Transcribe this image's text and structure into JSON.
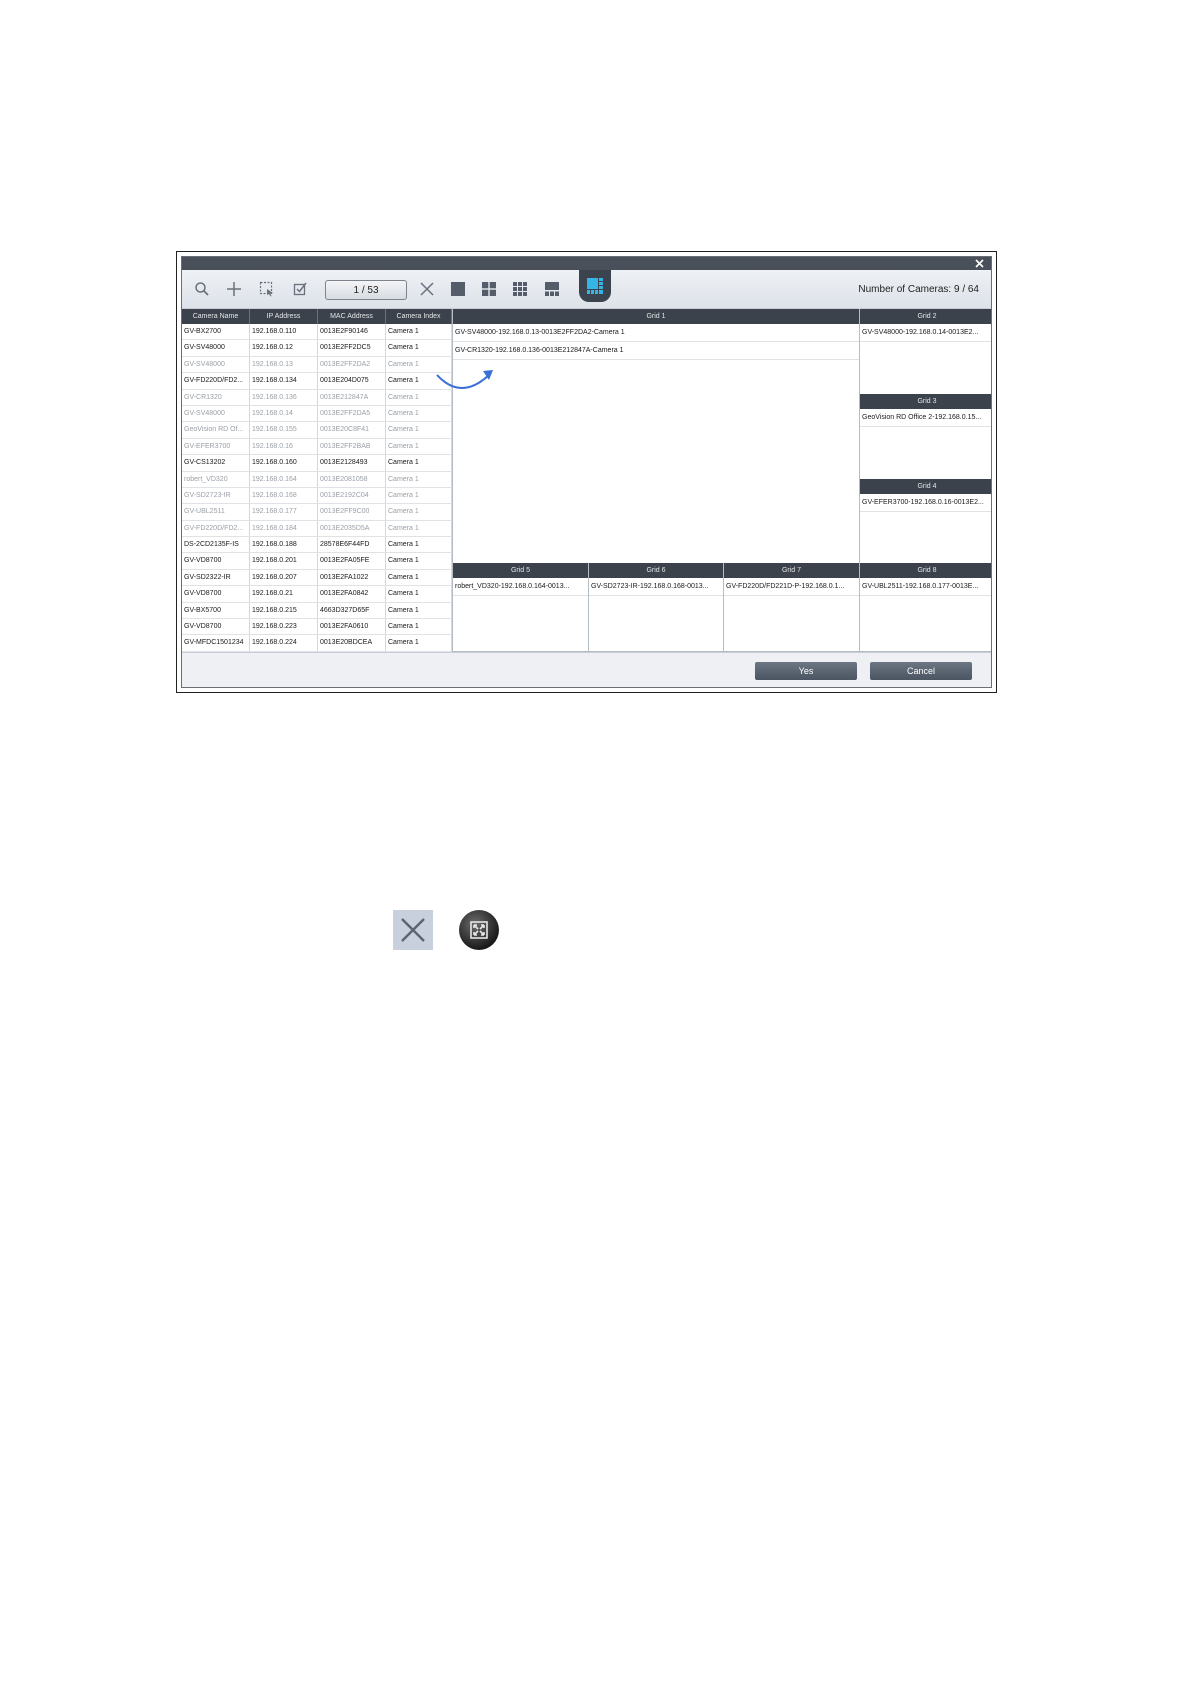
{
  "toolbar": {
    "page_indicator": "1 / 53",
    "camera_count": "Number of Cameras: 9 / 64"
  },
  "camera_table": {
    "headers": [
      "Camera Name",
      "IP Address",
      "MAC Address",
      "Camera Index"
    ],
    "rows": [
      {
        "name": "GV-BX2700",
        "ip": "192.168.0.110",
        "mac": "0013E2F90146",
        "index": "Camera 1",
        "dim": false
      },
      {
        "name": "GV-SV48000",
        "ip": "192.168.0.12",
        "mac": "0013E2FF2DC5",
        "index": "Camera 1",
        "dim": false
      },
      {
        "name": "GV-SV48000",
        "ip": "192.168.0.13",
        "mac": "0013E2FF2DA2",
        "index": "Camera 1",
        "dim": true
      },
      {
        "name": "GV-FD220D/FD2...",
        "ip": "192.168.0.134",
        "mac": "0013E204D075",
        "index": "Camera 1",
        "dim": false
      },
      {
        "name": "GV-CR1320",
        "ip": "192.168.0.136",
        "mac": "0013E212847A",
        "index": "Camera 1",
        "dim": true
      },
      {
        "name": "GV-SV48000",
        "ip": "192.168.0.14",
        "mac": "0013E2FF2DA5",
        "index": "Camera 1",
        "dim": true
      },
      {
        "name": "GeoVision RD Of...",
        "ip": "192.168.0.155",
        "mac": "0013E20C8F41",
        "index": "Camera 1",
        "dim": true
      },
      {
        "name": "GV-EFER3700",
        "ip": "192.168.0.16",
        "mac": "0013E2FF2BAB",
        "index": "Camera 1",
        "dim": true
      },
      {
        "name": "GV-CS13202",
        "ip": "192.168.0.160",
        "mac": "0013E2128493",
        "index": "Camera 1",
        "dim": false
      },
      {
        "name": "robert_VD320",
        "ip": "192.168.0.164",
        "mac": "0013E2081058",
        "index": "Camera 1",
        "dim": true
      },
      {
        "name": "GV-SD2723-IR",
        "ip": "192.168.0.168",
        "mac": "0013E2192C04",
        "index": "Camera 1",
        "dim": true
      },
      {
        "name": "GV-UBL2511",
        "ip": "192.168.0.177",
        "mac": "0013E2FF9C00",
        "index": "Camera 1",
        "dim": true
      },
      {
        "name": "GV-FD220D/FD2...",
        "ip": "192.168.0.184",
        "mac": "0013E2035D5A",
        "index": "Camera 1",
        "dim": true
      },
      {
        "name": "DS-2CD2135F-IS",
        "ip": "192.168.0.188",
        "mac": "28578E6F44FD",
        "index": "Camera 1",
        "dim": false
      },
      {
        "name": "GV-VD8700",
        "ip": "192.168.0.201",
        "mac": "0013E2FA05FE",
        "index": "Camera 1",
        "dim": false
      },
      {
        "name": "GV-SD2322-IR",
        "ip": "192.168.0.207",
        "mac": "0013E2FA1022",
        "index": "Camera 1",
        "dim": false
      },
      {
        "name": "GV-VD8700",
        "ip": "192.168.0.21",
        "mac": "0013E2FA0842",
        "index": "Camera 1",
        "dim": false
      },
      {
        "name": "GV-BX5700",
        "ip": "192.168.0.215",
        "mac": "4663D327D65F",
        "index": "Camera 1",
        "dim": false
      },
      {
        "name": "GV-VD8700",
        "ip": "192.168.0.223",
        "mac": "0013E2FA0610",
        "index": "Camera 1",
        "dim": false
      },
      {
        "name": "GV-MFDC1501234",
        "ip": "192.168.0.224",
        "mac": "0013E20BDCEA",
        "index": "Camera 1",
        "dim": false
      }
    ]
  },
  "grids": {
    "grid1": {
      "title": "Grid 1",
      "items": [
        "GV-SV48000-192.168.0.13-0013E2FF2DA2-Camera 1",
        "GV-CR1320-192.168.0.136-0013E212847A-Camera 1"
      ]
    },
    "grid2": {
      "title": "Grid 2",
      "items": [
        "GV-SV48000-192.168.0.14-0013E2..."
      ]
    },
    "grid3": {
      "title": "Grid 3",
      "items": [
        "GeoVision RD Office 2-192.168.0.15..."
      ]
    },
    "grid4": {
      "title": "Grid 4",
      "items": [
        "GV-EFER3700-192.168.0.16-0013E2..."
      ]
    },
    "grid5": {
      "title": "Grid 5",
      "items": [
        "robert_VD320-192.168.0.164-0013..."
      ]
    },
    "grid6": {
      "title": "Grid 6",
      "items": [
        "GV-SD2723-IR-192.168.0.168-0013..."
      ]
    },
    "grid7": {
      "title": "Grid 7",
      "items": [
        "GV-FD220D/FD221D-P-192.168.0.1..."
      ]
    },
    "grid8": {
      "title": "Grid 8",
      "items": [
        "GV-UBL2511-192.168.0.177-0013E..."
      ]
    }
  },
  "footer": {
    "yes_label": "Yes",
    "cancel_label": "Cancel"
  },
  "colors": {
    "header_dark": "#3b424b",
    "active_icon": "#35b5e6",
    "arrow": "#3a6fd8",
    "button": "#5a6470"
  },
  "icons": [
    "search-icon",
    "add-icon",
    "select-icon",
    "check-icon",
    "clear-icon",
    "layout-1-icon",
    "layout-4-icon",
    "layout-9-icon",
    "layout-6-icon",
    "layout-custom-icon",
    "close-icon",
    "fullscreen-icon"
  ]
}
